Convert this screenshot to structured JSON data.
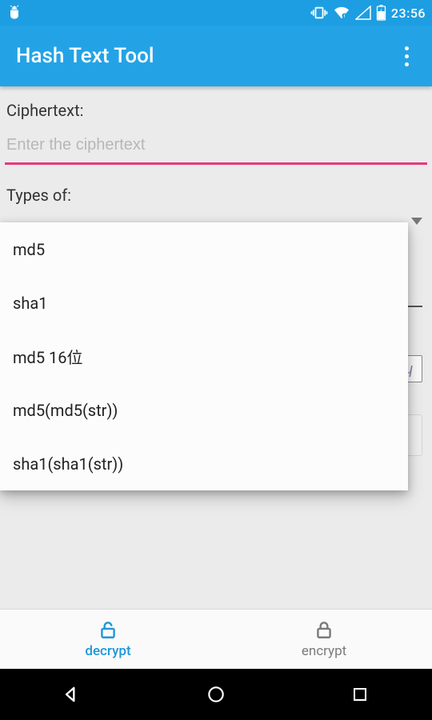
{
  "status": {
    "time": "23:56"
  },
  "appbar": {
    "title": "Hash Text Tool"
  },
  "form": {
    "ciphertext_label": "Ciphertext:",
    "ciphertext_placeholder": "Enter the ciphertext",
    "types_label": "Types of:"
  },
  "dropdown": {
    "items": [
      {
        "label": "md5"
      },
      {
        "label": "sha1"
      },
      {
        "label": "md5 16位"
      },
      {
        "label": "md5(md5(str))"
      },
      {
        "label": "sha1(sha1(str))"
      }
    ]
  },
  "tabs": {
    "decrypt": "decrypt",
    "encrypt": "encrypt"
  }
}
